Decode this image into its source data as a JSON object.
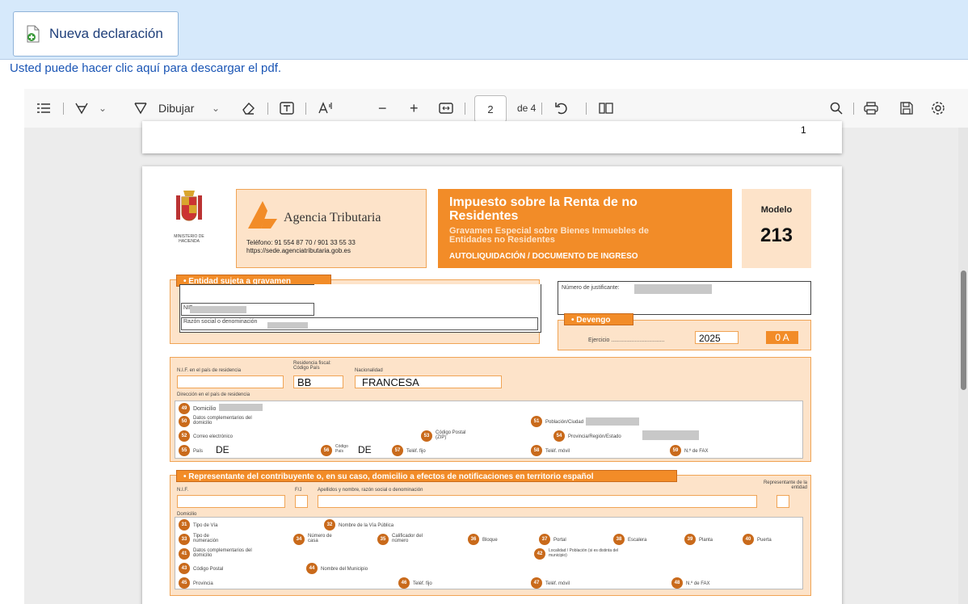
{
  "header": {
    "new_button_label": "Nueva declaración",
    "download_text": "Usted puede hacer clic aquí para descargar el pdf."
  },
  "toolbar": {
    "draw_label": "Dibujar",
    "page_current": "2",
    "page_total": "de 4"
  },
  "page1": {
    "footer_number": "1"
  },
  "form": {
    "agency_name": "Agencia Tributaria",
    "ministry": "MINISTERIO DE HACIENDA",
    "phone": "Teléfono: 91 554 87 70 / 901 33 55 33",
    "url": "https://sede.agenciatributaria.gob.es",
    "title1": "Impuesto sobre la Renta de no",
    "title2": "Residentes",
    "subtitle1": "Gravamen Especial sobre Bienes Inmuebles de",
    "subtitle2": "Entidades no Residentes",
    "subtitle3": "AUTOLIQUIDACIÓN / DOCUMENTO DE INGRESO",
    "modelo_label": "Modelo",
    "modelo_number": "213",
    "sec_entidad": "• Entidad sujeta a gravamen",
    "nif_short": "NIF",
    "razon_social": "Razón social o denominación",
    "num_justificante": "Número de justificante:",
    "sec_devengo": "• Devengo",
    "ejercicio_label": "Ejercicio ..................................",
    "ejercicio_value": "2025",
    "periodo_value": "0 A",
    "nif_pais": "N.I.F. en el país de residencia",
    "residencia_fiscal": "Residencia fiscal: Código País",
    "residencia_value": "BB",
    "nacionalidad": "Nacionalidad",
    "nacionalidad_value": "FRANCESA",
    "direccion_pais": "Dirección en el país de residencia",
    "f49": "Domicilio",
    "f50": "Datos complementarios del domicilio",
    "f51": "Población/Ciudad",
    "f52": "Correo electrónico",
    "f53": "Código Postal (ZIP)",
    "f54": "Provincia/Región/Estado",
    "f55": "País",
    "f55_value": "DE",
    "f56": "Código País",
    "f56_value": "DE",
    "f57": "Teléf. fijo",
    "f58": "Teléf. móvil",
    "f59": "N.º de FAX",
    "sec_representante": "• Representante del contribuyente o, en su caso, domicilio a efectos de notificaciones en territorio español",
    "rep_nif": "N.I.F.",
    "rep_fj": "F/J",
    "rep_nombre": "Apellidos y nombre, razón social o denominación",
    "rep_entidad": "Representante de la entidad",
    "domicilio": "Domicilio",
    "f31": "Tipo de Vía",
    "f32": "Nombre de la Vía Pública",
    "f33": "Tipo de numeración",
    "f34": "Número de casa",
    "f35": "Calificador del número",
    "f36": "Bloque",
    "f37": "Portal",
    "f38": "Escalera",
    "f39": "Planta",
    "f40": "Puerta",
    "f41": "Datos complementarios del domicilio",
    "f42": "Localidad / Población (si es distinta del municipio)",
    "f43": "Código Postal",
    "f44": "Nombre del Municipio",
    "f45": "Provincia",
    "f46": "Teléf. fijo",
    "f47": "Teléf. móvil",
    "f48": "N.º de FAX",
    "n31": "31",
    "n32": "32",
    "n33": "33",
    "n34": "34",
    "n35": "35",
    "n36": "36",
    "n37": "37",
    "n38": "38",
    "n39": "39",
    "n40": "40",
    "n41": "41",
    "n42": "42",
    "n43": "43",
    "n44": "44",
    "n45": "45",
    "n46": "46",
    "n47": "47",
    "n48": "48",
    "n49": "49",
    "n50": "50",
    "n51": "51",
    "n52": "52",
    "n53": "53",
    "n54": "54",
    "n55": "55",
    "n56": "56",
    "n57": "57",
    "n58": "58",
    "n59": "59"
  },
  "colors": {
    "accent": "#f28c28",
    "light_orange": "#fde3c9",
    "topbar": "#d6e9fb",
    "link": "#1a55b5"
  }
}
